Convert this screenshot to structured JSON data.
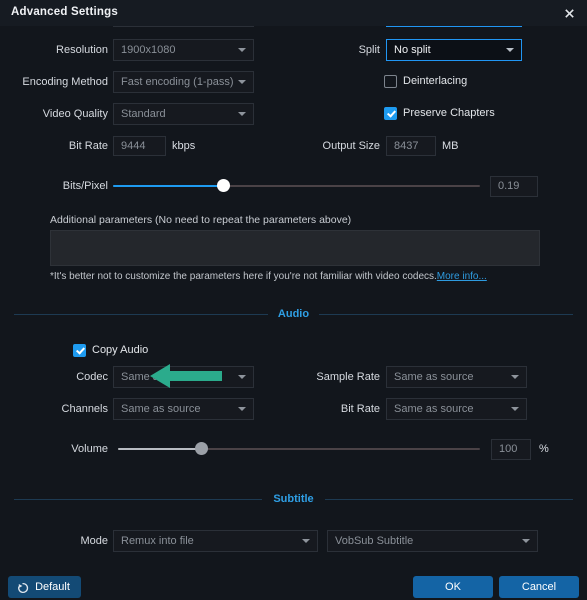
{
  "window": {
    "title": "Advanced Settings",
    "close_icon": "close-icon"
  },
  "video": {
    "resolution": {
      "label": "Resolution",
      "value": "1900x1080",
      "enabled": false
    },
    "encoding_method": {
      "label": "Encoding Method",
      "value": "Fast encoding (1-pass)",
      "enabled": false
    },
    "video_quality": {
      "label": "Video Quality",
      "value": "Standard",
      "enabled": false
    },
    "bit_rate": {
      "label": "Bit Rate",
      "value": "9444",
      "unit": "kbps"
    },
    "split": {
      "label": "Split",
      "value": "No split",
      "focused": true
    },
    "deinterlacing": {
      "label": "Deinterlacing",
      "checked": false
    },
    "preserve_chapters": {
      "label": "Preserve Chapters",
      "checked": true
    },
    "output_size": {
      "label": "Output Size",
      "value": "8437",
      "unit": "MB"
    },
    "bits_per_pixel": {
      "label": "Bits/Pixel",
      "value": "0.19",
      "percent": 30
    },
    "additional_parameters": {
      "hint": "Additional parameters (No need to repeat the parameters above)",
      "value": "",
      "placeholder": ""
    },
    "codec_note": "*It's better not to customize the parameters here if you're not familiar with video codecs.",
    "more_info": "More info..."
  },
  "audio": {
    "section_title": "Audio",
    "copy_audio": {
      "label": "Copy Audio",
      "checked": true
    },
    "codec": {
      "label": "Codec",
      "value": "Same as source"
    },
    "sample_rate": {
      "label": "Sample Rate",
      "value": "Same as source"
    },
    "channels": {
      "label": "Channels",
      "value": "Same as source"
    },
    "bit_rate": {
      "label": "Bit Rate",
      "value": "Same as source"
    },
    "volume": {
      "label": "Volume",
      "value": "100",
      "unit": "%",
      "percent": 23
    }
  },
  "subtitle": {
    "section_title": "Subtitle",
    "mode": {
      "label": "Mode",
      "value": "Remux into file"
    },
    "format": {
      "value": "VobSub Subtitle"
    }
  },
  "footer": {
    "default_label": "Default",
    "ok_label": "OK",
    "cancel_label": "Cancel"
  },
  "annotation": {
    "arrow_color": "#2bab8c",
    "points_to": "Copy Audio checkbox"
  },
  "colors": {
    "accent": "#1e9bf0",
    "section": "#2f9fe5",
    "primary_button": "#1464a5",
    "arrow": "#2bab8c"
  }
}
